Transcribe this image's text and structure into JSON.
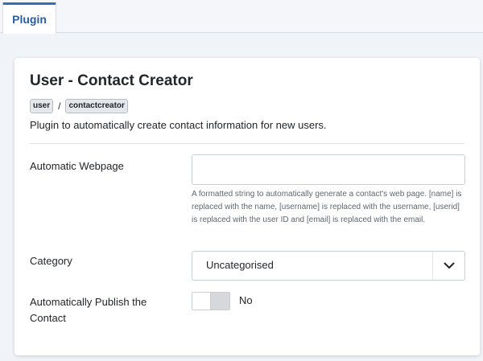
{
  "tabs": [
    {
      "label": "Plugin",
      "active": true
    }
  ],
  "plugin": {
    "title": "User - Contact Creator",
    "badges": [
      "user",
      "contactcreator"
    ],
    "badge_separator": "/",
    "description": "Plugin to automatically create contact information for new users."
  },
  "fields": {
    "webpage": {
      "label": "Automatic Webpage",
      "value": "",
      "placeholder": "",
      "help": "A formatted string to automatically generate a contact's web page. [name] is replaced with the name, [username] is replaced with the username, [userid] is replaced with the user ID and [email] is replaced with the email."
    },
    "category": {
      "label": "Category",
      "selected": "Uncategorised"
    },
    "autopublish": {
      "label": "Automatically Publish the Contact",
      "state_label": "No",
      "enabled": false
    }
  },
  "colors": {
    "accent": "#3071b4",
    "tab_text": "#2a5da4",
    "background": "#f0f4f8"
  }
}
